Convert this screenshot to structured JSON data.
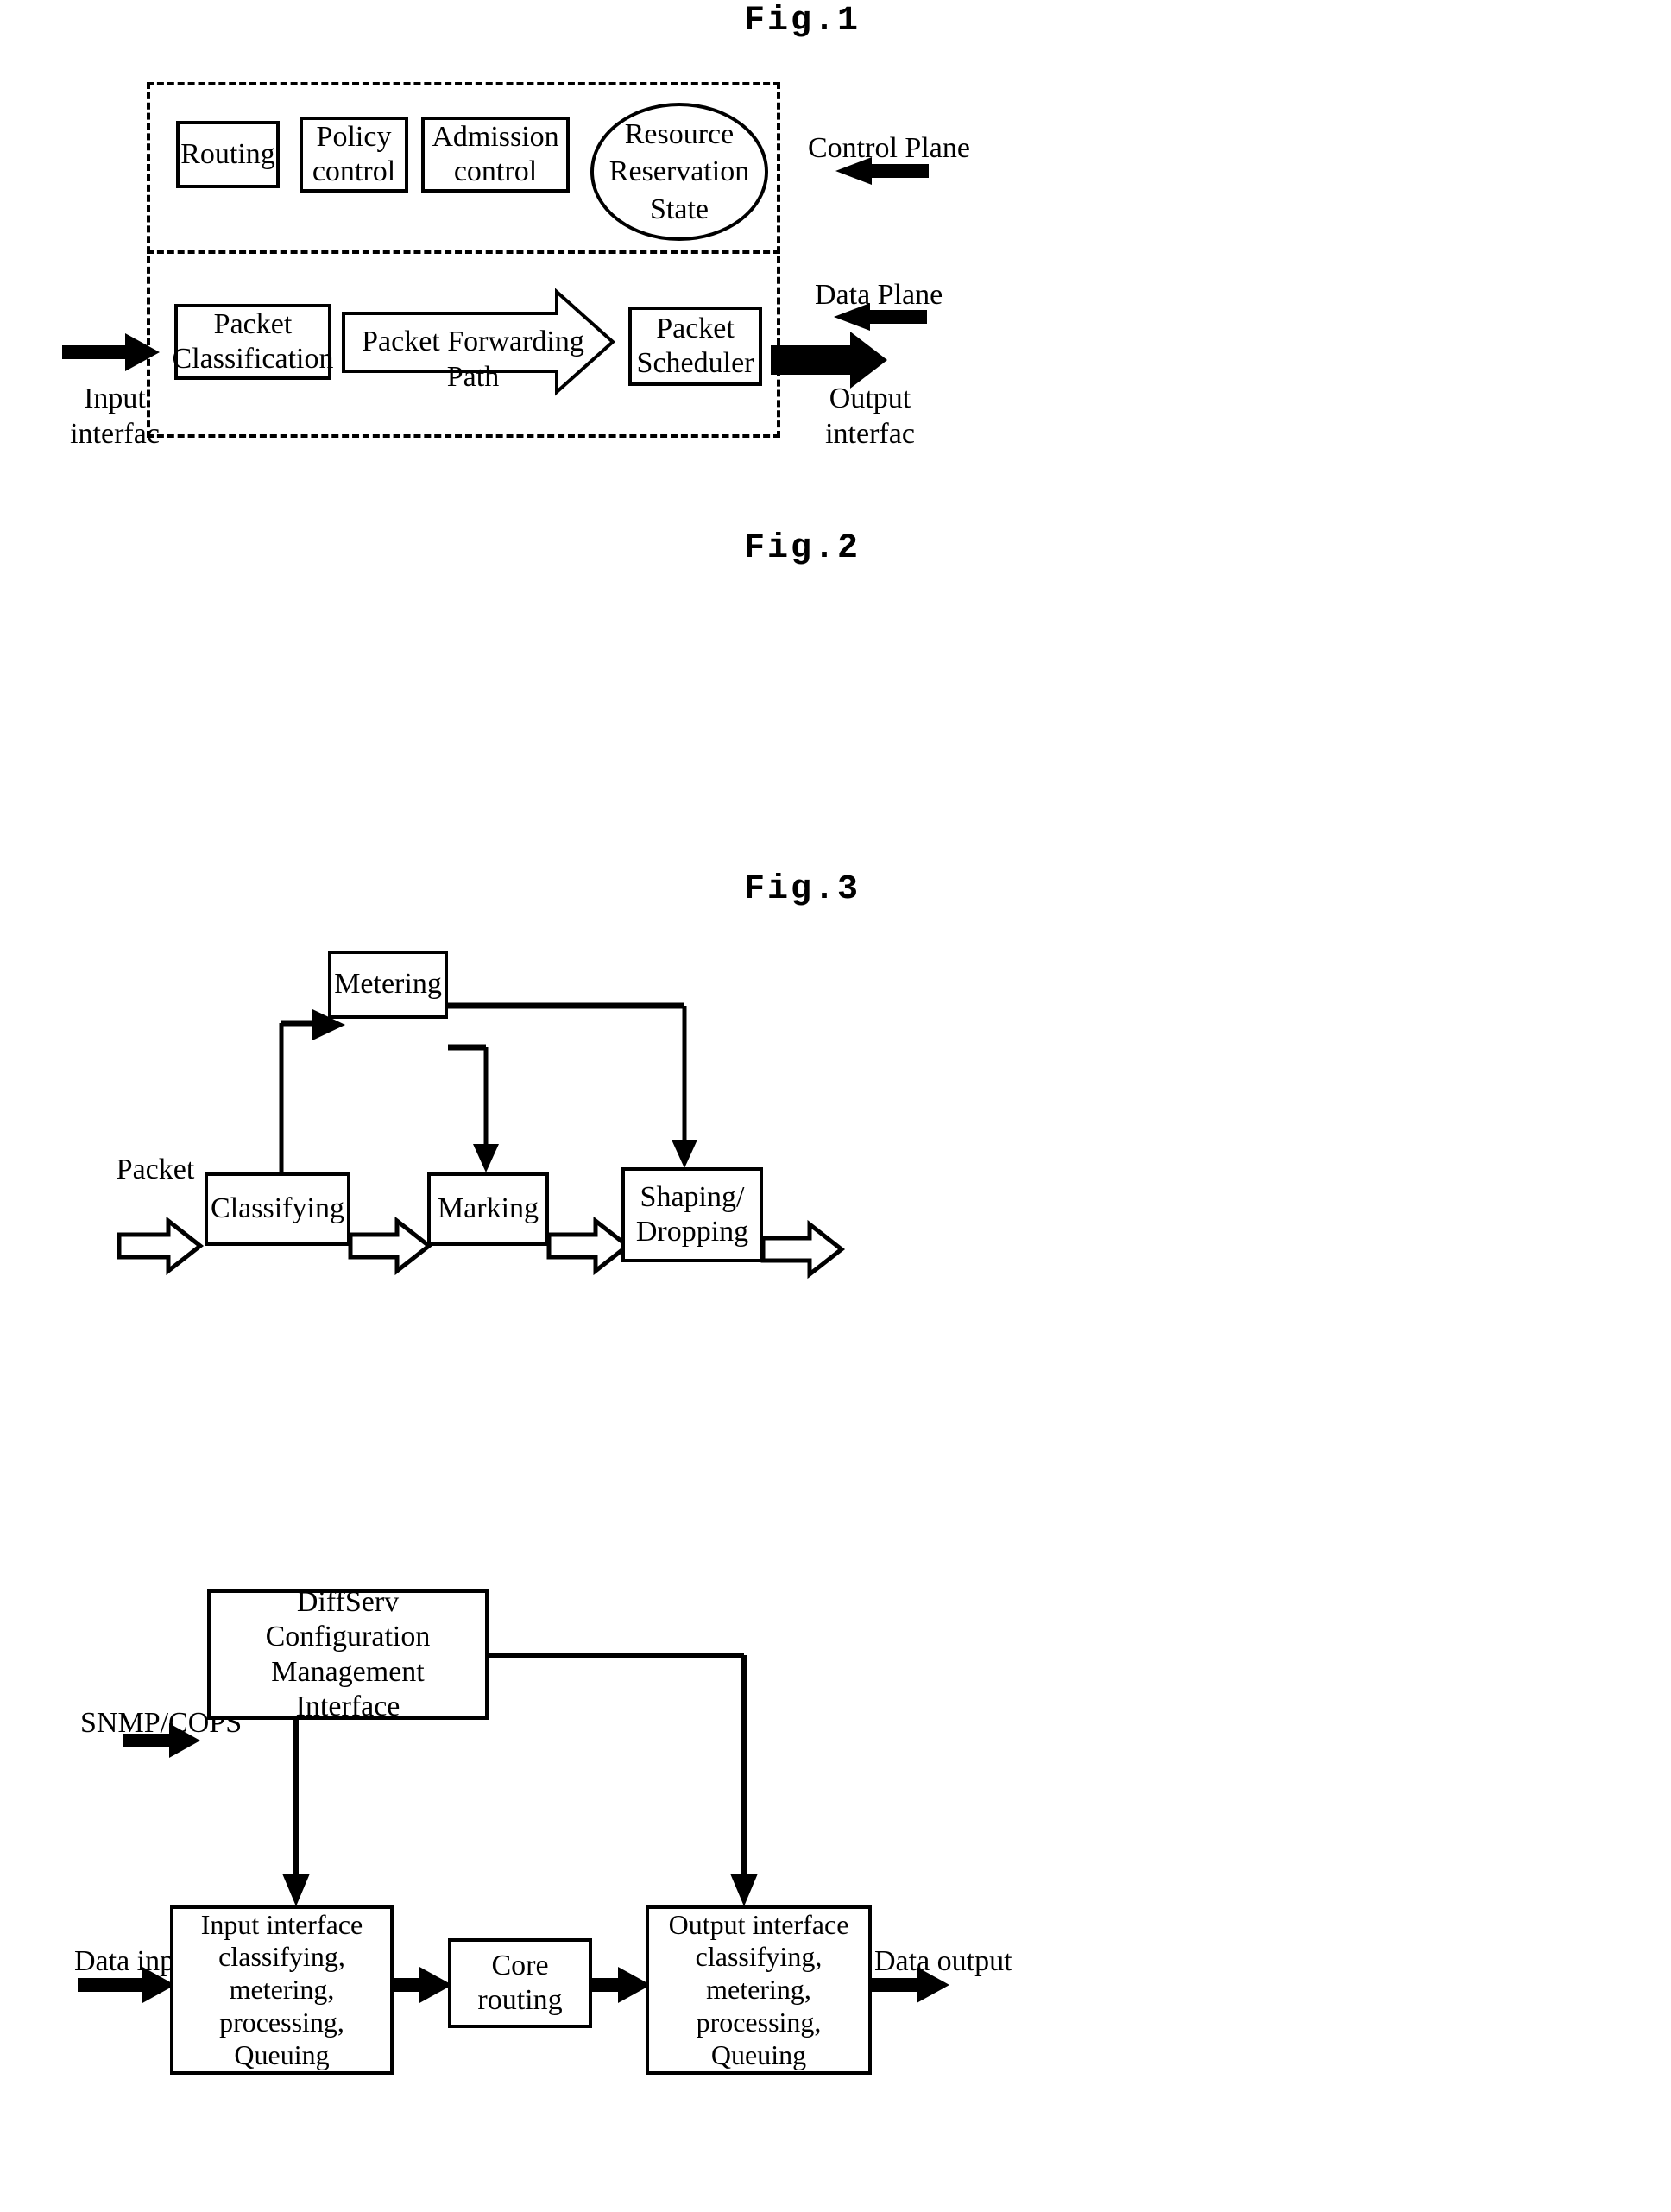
{
  "figures": [
    {
      "title": "Fig.1",
      "panes": {
        "control": "Control Plane",
        "data": "Data Plane"
      },
      "boxes": {
        "routing": "Routing",
        "policy_control": "Policy\ncontrol",
        "admission_control": "Admission\ncontrol",
        "resource_reservation_state": "Resource\nReservation\nState",
        "packet_classification": "Packet\nClassification",
        "packet_forwarding_path": "Packet Forwarding Path",
        "packet_scheduler": "Packet\nScheduler"
      },
      "labels": {
        "input_interface": "Input\ninterfac",
        "output_interface": "Output\ninterfac"
      }
    },
    {
      "title": "Fig.2",
      "boxes": {
        "metering": "Metering",
        "classifying": "Classifying",
        "marking": "Marking",
        "shaping_dropping": "Shaping/\nDropping"
      },
      "labels": {
        "packet": "Packet"
      }
    },
    {
      "title": "Fig.3",
      "boxes": {
        "diffserv": "DiffServ\nConfiguration\nManagement Interface",
        "input_interface": "Input interface\nclassifying,\nmetering,\nprocessing, Queuing",
        "core_routing": "Core\nrouting",
        "output_interface": "Output interface\nclassifying,\nmetering,\nprocessing, Queuing"
      },
      "labels": {
        "snmp_cops": "SNMP/COPS",
        "data_input": "Data input",
        "data_output": "Data output"
      }
    }
  ],
  "colors": {
    "ink": "#000000",
    "paper": "#ffffff"
  }
}
